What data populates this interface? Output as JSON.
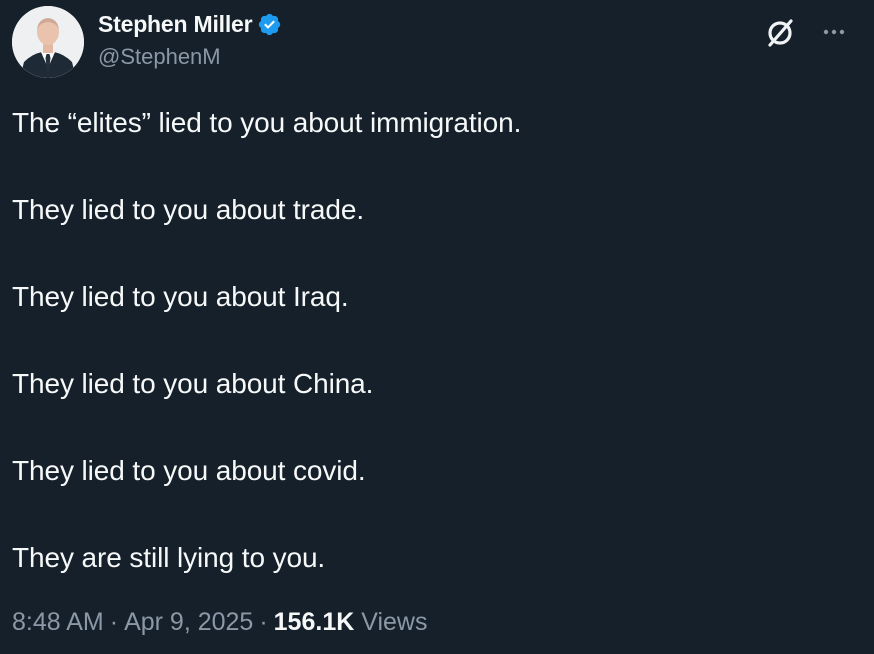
{
  "author": {
    "display_name": "Stephen Miller",
    "handle": "@StephenM",
    "verified": true,
    "badge_color": "#1d9bf0"
  },
  "tweet": {
    "lines": [
      "The “elites” lied to you about immigration.",
      "They lied to you about trade.",
      "They lied to you about Iraq.",
      "They lied to you about China.",
      "They lied to you about covid.",
      "They are still lying to you."
    ]
  },
  "meta": {
    "time": "8:48 AM",
    "separator": "·",
    "date": "Apr 9, 2025",
    "views_count": "156.1K",
    "views_label": "Views"
  },
  "actions": {
    "grok_icon": "grok-icon",
    "more_icon": "more-options-icon"
  },
  "theme": {
    "background": "#15202b",
    "text": "#f7f9f9",
    "secondary_text": "#8b98a5"
  }
}
